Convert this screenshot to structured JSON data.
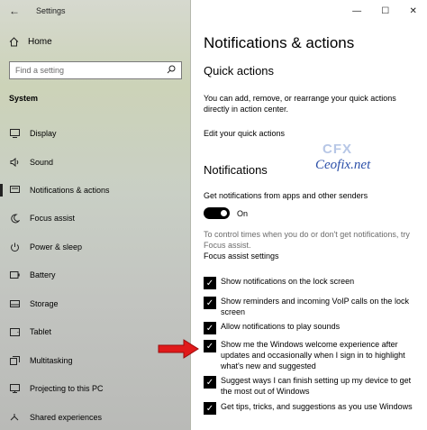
{
  "window": {
    "title": "Settings",
    "controls": {
      "minimize": "—",
      "maximize": "☐",
      "close": "✕"
    }
  },
  "nav": {
    "home_label": "Home",
    "search_placeholder": "Find a setting",
    "section_label": "System",
    "items": [
      {
        "label": "Display",
        "icon": "display-icon"
      },
      {
        "label": "Sound",
        "icon": "sound-icon"
      },
      {
        "label": "Notifications & actions",
        "icon": "notifications-icon",
        "active": true
      },
      {
        "label": "Focus assist",
        "icon": "moon-icon"
      },
      {
        "label": "Power & sleep",
        "icon": "power-icon"
      },
      {
        "label": "Battery",
        "icon": "battery-icon"
      },
      {
        "label": "Storage",
        "icon": "storage-icon"
      },
      {
        "label": "Tablet",
        "icon": "tablet-icon"
      },
      {
        "label": "Multitasking",
        "icon": "multitasking-icon"
      },
      {
        "label": "Projecting to this PC",
        "icon": "projecting-icon"
      },
      {
        "label": "Shared experiences",
        "icon": "shared-icon"
      }
    ]
  },
  "main": {
    "title": "Notifications & actions",
    "quick_actions": {
      "heading": "Quick actions",
      "description": "You can add, remove, or rearrange your quick actions directly in action center.",
      "edit_link": "Edit your quick actions"
    },
    "notifications": {
      "heading": "Notifications",
      "toggle_label": "Get notifications from apps and other senders",
      "toggle_state": "On",
      "focus_hint": "To control times when you do or don't get notifications, try Focus assist.",
      "focus_link": "Focus assist settings",
      "checkboxes": [
        {
          "label": "Show notifications on the lock screen",
          "checked": true
        },
        {
          "label": "Show reminders and incoming VoIP calls on the lock screen",
          "checked": true
        },
        {
          "label": "Allow notifications to play sounds",
          "checked": true
        },
        {
          "label": "Show me the Windows welcome experience after updates and occasionally when I sign in to highlight what's new and suggested",
          "checked": true
        },
        {
          "label": "Suggest ways I can finish setting up my device to get the most out of Windows",
          "checked": true
        },
        {
          "label": "Get tips, tricks, and suggestions as you use Windows",
          "checked": true
        }
      ]
    }
  },
  "watermark": {
    "logo": "CFX",
    "text": "Ceofix.net"
  },
  "colors": {
    "accent": "#000000",
    "arrow": "#e01a1a",
    "watermark": "#2b4fa8"
  }
}
